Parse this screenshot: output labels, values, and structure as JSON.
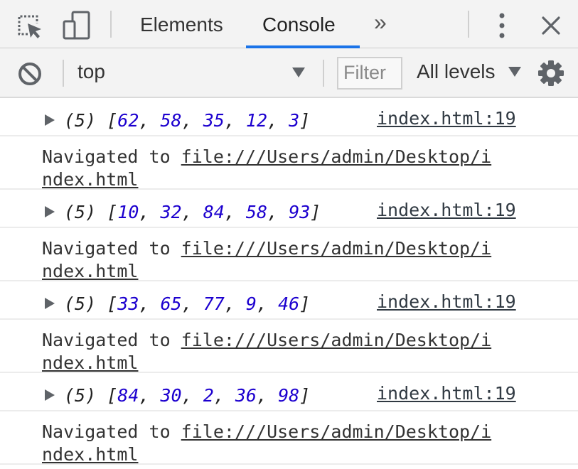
{
  "tabbar": {
    "inspect_icon": "inspect-element-icon",
    "device_icon": "device-toolbar-icon",
    "tabs": [
      {
        "label": "Elements",
        "active": false
      },
      {
        "label": "Console",
        "active": true
      }
    ],
    "more_tabs_label": "»",
    "menu_icon": "kebab-menu-icon",
    "close_icon": "close-icon",
    "accent_color": "#1a73e8"
  },
  "toolbar": {
    "clear_icon": "clear-console-icon",
    "context": "top",
    "filter_placeholder": "Filter",
    "levels": "All levels",
    "settings_icon": "gear-icon"
  },
  "console": {
    "messages": [
      {
        "type": "log",
        "count": "(5)",
        "values": [
          "62",
          "58",
          "35",
          "12",
          "3"
        ],
        "source": "index.html:19"
      },
      {
        "type": "nav",
        "prefix": "Navigated to ",
        "url_line1": "file:///Users/admin/Desktop/i",
        "url_line2": "ndex.html"
      },
      {
        "type": "log",
        "count": "(5)",
        "values": [
          "10",
          "32",
          "84",
          "58",
          "93"
        ],
        "source": "index.html:19"
      },
      {
        "type": "nav",
        "prefix": "Navigated to ",
        "url_line1": "file:///Users/admin/Desktop/i",
        "url_line2": "ndex.html"
      },
      {
        "type": "log",
        "count": "(5)",
        "values": [
          "33",
          "65",
          "77",
          "9",
          "46"
        ],
        "source": "index.html:19"
      },
      {
        "type": "nav",
        "prefix": "Navigated to ",
        "url_line1": "file:///Users/admin/Desktop/i",
        "url_line2": "ndex.html"
      },
      {
        "type": "log",
        "count": "(5)",
        "values": [
          "84",
          "30",
          "2",
          "36",
          "98"
        ],
        "source": "index.html:19"
      },
      {
        "type": "nav",
        "prefix": "Navigated to ",
        "url_line1": "file:///Users/admin/Desktop/i",
        "url_line2": "ndex.html"
      }
    ]
  }
}
